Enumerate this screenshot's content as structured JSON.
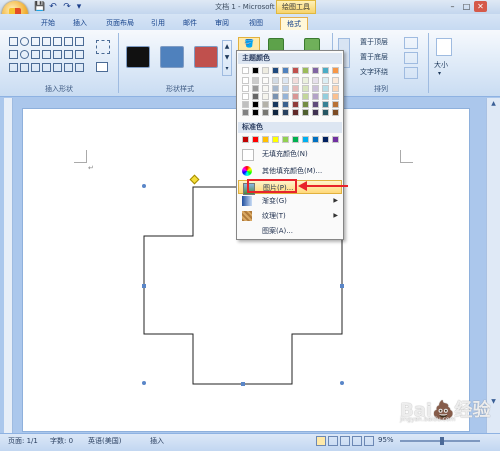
{
  "window": {
    "title": "文档 1 - Microsoft Word",
    "context_tab_group": "绘图工具",
    "min": "–",
    "max": "□",
    "close": "✕"
  },
  "qat": {
    "save": "💾",
    "undo": "↶",
    "redo": "↷",
    "more": "▾"
  },
  "tabs": [
    "开始",
    "插入",
    "页面布局",
    "引用",
    "邮件",
    "审阅",
    "视图",
    "格式"
  ],
  "active_tab": "格式",
  "ribbon": {
    "groups": {
      "insert_shapes": "插入形状",
      "shape_styles": "形状样式",
      "arrange": "排列",
      "size": "大小"
    },
    "arrange_buttons": [
      "置于顶层",
      "置于底层",
      "文字环绕"
    ],
    "size_label": "大小"
  },
  "style_swatches": [
    "#111111",
    "#4f81bd",
    "#c0504d"
  ],
  "dropdown": {
    "theme_colors_label": "主题颜色",
    "standard_colors_label": "标准色",
    "theme_top": [
      "#ffffff",
      "#000000",
      "#eeece1",
      "#1f497d",
      "#4f81bd",
      "#c0504d",
      "#9bbb59",
      "#8064a2",
      "#4bacc6",
      "#f79646"
    ],
    "standard": [
      "#c00000",
      "#ff0000",
      "#ffc000",
      "#ffff00",
      "#92d050",
      "#00b050",
      "#00b0f0",
      "#0070c0",
      "#002060",
      "#7030a0"
    ],
    "items": {
      "no_fill": "无填充颜色(N)",
      "more_colors": "其他填充颜色(M)...",
      "picture": "图片(P)...",
      "gradient": "渐变(G)",
      "texture": "纹理(T)",
      "pattern": "图案(A)..."
    }
  },
  "status": {
    "page": "页面: 1/1",
    "words": "字数: 0",
    "language": "英语(美国)",
    "insert": "插入",
    "zoom": "95%"
  },
  "watermark": {
    "main": "Bai💩经验",
    "sub": "jingyan.baidu.com"
  },
  "colors": {
    "accent_red": "#e8232a",
    "ribbon_blue": "#c9dcf2"
  }
}
